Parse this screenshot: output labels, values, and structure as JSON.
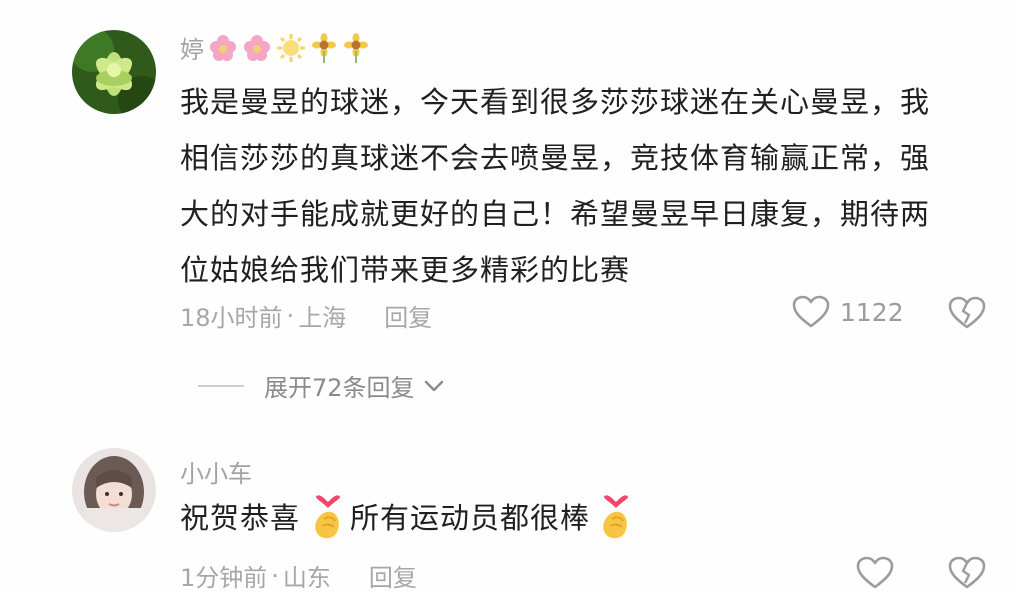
{
  "comments": [
    {
      "username": "婷",
      "username_emojis": [
        "flower-icon",
        "flower-icon",
        "sun-icon",
        "sunflower-icon",
        "sunflower-icon"
      ],
      "lines": [
        "我是曼昱的球迷，今天看到很多莎莎球迷在关心曼昱，我",
        "相信莎莎的真球迷不会去喷曼昱，竞技体育输赢正常，强",
        "大的对手能成就更好的自己！希望曼昱早日康复，期待两",
        "位姑娘给我们带来更多精彩的比赛"
      ],
      "time": "18小时前",
      "dot": "·",
      "location": "上海",
      "reply_label": "回复",
      "like_count": "1122",
      "expand_label": "展开72条回复"
    },
    {
      "username": "小小车",
      "text_part1": "祝贺恭喜",
      "text_part2": "所有运动员都很棒",
      "emoji": "finger-heart-icon",
      "time": "1分钟前",
      "dot": "·",
      "location": "山东",
      "reply_label": "回复"
    }
  ],
  "colors": {
    "username": "#a3a3a3",
    "body": "#202020",
    "meta": "#a7a7a7"
  }
}
